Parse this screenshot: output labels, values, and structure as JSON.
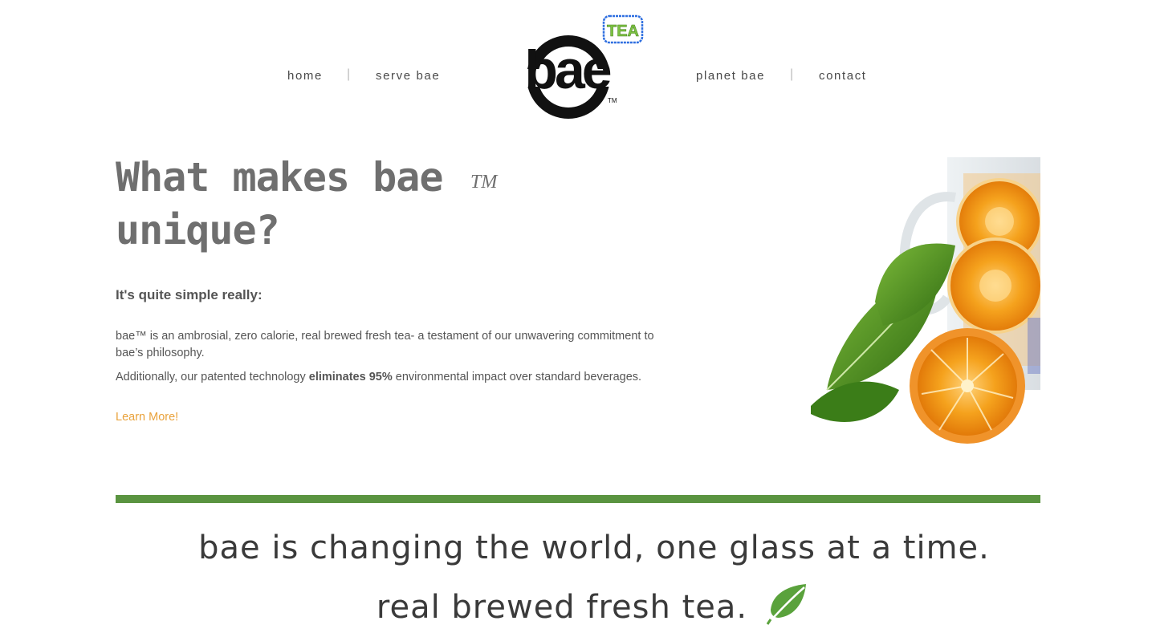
{
  "nav": {
    "left": [
      {
        "label": "home"
      },
      {
        "label": "serve bae"
      }
    ],
    "right": [
      {
        "label": "planet bae"
      },
      {
        "label": "contact"
      }
    ],
    "separator": "|"
  },
  "logo": {
    "wordmark": "bae",
    "badge": "TEA",
    "trademark": "TM"
  },
  "hero": {
    "headline_line1": "What makes bae",
    "headline_tm": "TM",
    "headline_line2": "unique?",
    "subhead": "It's quite simple really:",
    "paragraph1": "bae™ is an ambrosial, zero calorie, real brewed fresh tea- a testament of our unwavering commitment to bae’s philosophy.",
    "paragraph2_prefix": "Additionally, our patented technology ",
    "paragraph2_bold": "eliminates 95%",
    "paragraph2_suffix": " environmental impact over standard beverages.",
    "link_label": "Learn More!"
  },
  "tagline": {
    "line1": "bae is changing the world, one glass at a time.",
    "line2": "real brewed fresh tea."
  },
  "colors": {
    "accent_green": "#5a9440",
    "link_orange": "#e9a23b",
    "badge_green": "#7cc142",
    "badge_blue": "#2f6fe0"
  }
}
